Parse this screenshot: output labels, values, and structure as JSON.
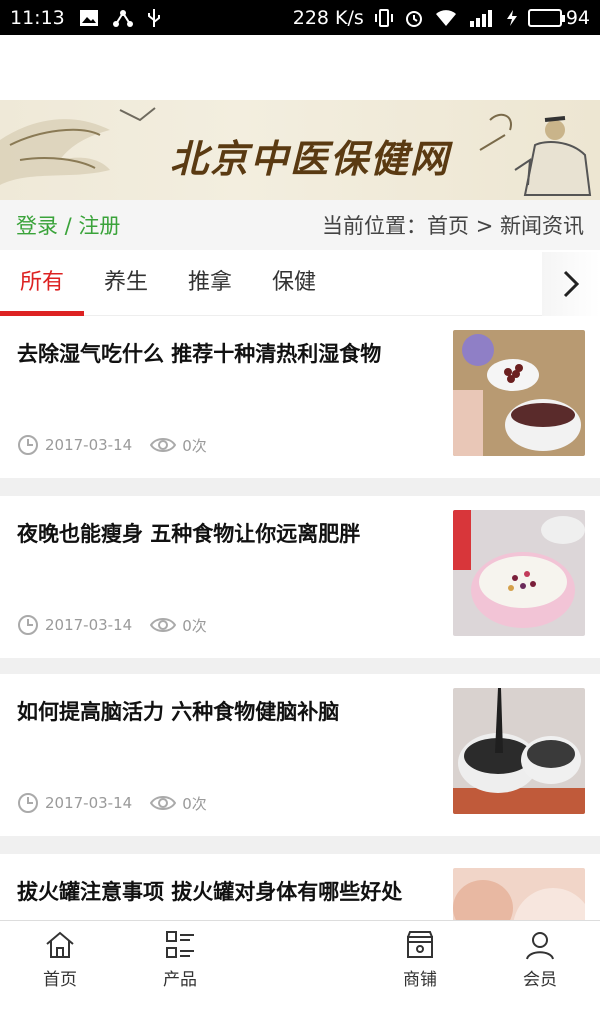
{
  "status_bar": {
    "time": "11:13",
    "speed": "228 K/s",
    "battery": "94",
    "battery_level": 0.94
  },
  "banner": {
    "title": "北京中医保健网"
  },
  "breadcrumb": {
    "login": "登录 / 注册",
    "position": "当前位置：首页 > 新闻资讯"
  },
  "tabs": [
    {
      "label": "所有",
      "active": true
    },
    {
      "label": "养生",
      "active": false
    },
    {
      "label": "推拿",
      "active": false
    },
    {
      "label": "保健",
      "active": false
    }
  ],
  "news": [
    {
      "title": "去除湿气吃什么 推荐十种清热利湿食物",
      "date": "2017-03-14",
      "views": "0次"
    },
    {
      "title": "夜晚也能瘦身 五种食物让你远离肥胖",
      "date": "2017-03-14",
      "views": "0次"
    },
    {
      "title": "如何提高脑活力 六种食物健脑补脑",
      "date": "2017-03-14",
      "views": "0次"
    },
    {
      "title": "拔火罐注意事项 拔火罐对身体有哪些好处",
      "date": "",
      "views": ""
    }
  ],
  "bottom_nav": [
    {
      "label": "首页",
      "icon": "home-icon"
    },
    {
      "label": "产品",
      "icon": "list-icon"
    },
    {
      "label": "商铺",
      "icon": "store-icon"
    },
    {
      "label": "会员",
      "icon": "user-icon"
    }
  ],
  "colors": {
    "accent_red": "#dd2222",
    "login_green": "#3aa33a"
  }
}
